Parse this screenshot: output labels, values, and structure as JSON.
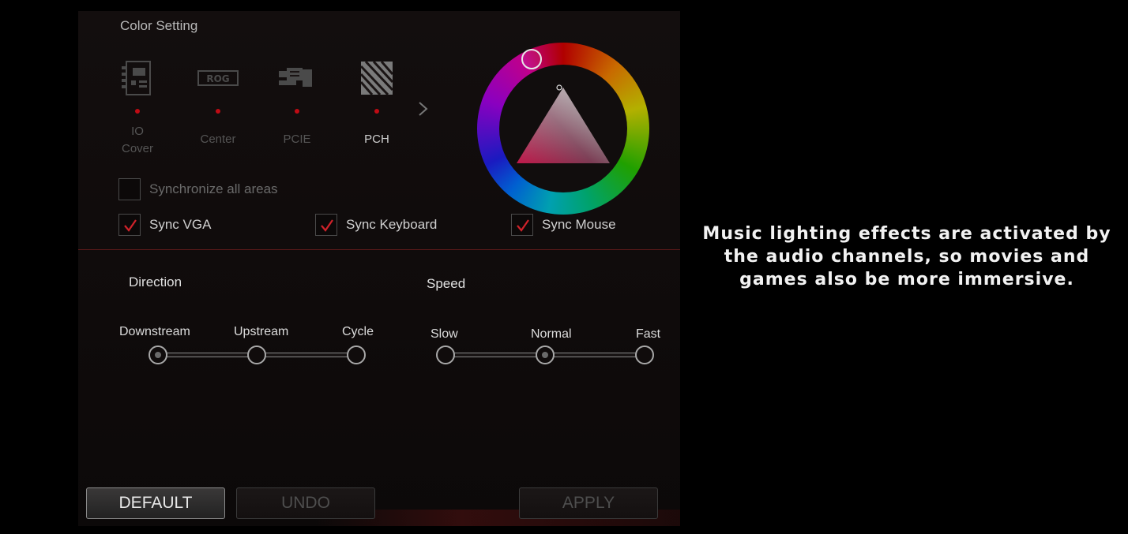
{
  "color_setting": {
    "title": "Color Setting",
    "areas": [
      {
        "icon": "motherboard-icon",
        "label": "IO\nCover",
        "active": false
      },
      {
        "icon": "rog-logo-icon",
        "label": "Center",
        "active": false
      },
      {
        "icon": "pcie-slot-icon",
        "label": "PCIE",
        "active": false
      },
      {
        "icon": "pch-heatsink-icon",
        "label": "PCH",
        "active": true
      }
    ],
    "next_icon": "chevron-right-icon",
    "color_wheel_icon": "hue-ring-icon",
    "selected_hue": "#c00014"
  },
  "sync": {
    "all_areas": {
      "label": "Synchronize all areas",
      "checked": false
    },
    "vga": {
      "label": "Sync VGA",
      "checked": true
    },
    "keyboard": {
      "label": "Sync Keyboard",
      "checked": true
    },
    "mouse": {
      "label": "Sync Mouse",
      "checked": true
    }
  },
  "direction": {
    "title": "Direction",
    "options": [
      "Downstream",
      "Upstream",
      "Cycle"
    ],
    "selected": "Downstream"
  },
  "speed": {
    "title": "Speed",
    "options": [
      "Slow",
      "Normal",
      "Fast"
    ],
    "selected": "Normal"
  },
  "buttons": {
    "default": "DEFAULT",
    "undo": "UNDO",
    "apply": "APPLY"
  },
  "caption": "Music lighting effects are activated by the audio channels, so movies and games also be more immersive.",
  "colors": {
    "accent": "#c00b14",
    "check": "#d0222a"
  }
}
